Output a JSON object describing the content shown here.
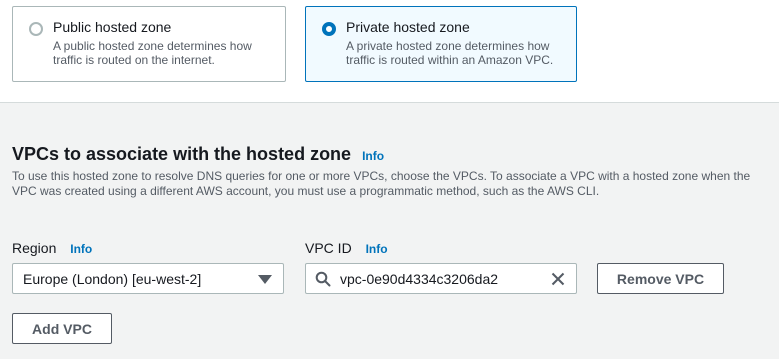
{
  "zone_type": {
    "options": [
      {
        "title": "Public hosted zone",
        "description": "A public hosted zone determines how traffic is routed on the internet.",
        "selected": false
      },
      {
        "title": "Private hosted zone",
        "description": "A private hosted zone determines how traffic is routed within an Amazon VPC.",
        "selected": true
      }
    ]
  },
  "vpc_section": {
    "title": "VPCs to associate with the hosted zone",
    "info_label": "Info",
    "description": "To use this hosted zone to resolve DNS queries for one or more VPCs, choose the VPCs. To associate a VPC with a hosted zone when the VPC was created using a different AWS account, you must use a programmatic method, such as the AWS CLI."
  },
  "region": {
    "label": "Region",
    "info_label": "Info",
    "value": "Europe (London) [eu-west-2]"
  },
  "vpc_id": {
    "label": "VPC ID",
    "info_label": "Info",
    "value": "vpc-0e90d4334c3206da2"
  },
  "buttons": {
    "remove_vpc": "Remove VPC",
    "add_vpc": "Add VPC"
  },
  "colors": {
    "accent": "#0073bb",
    "text": "#16191f",
    "secondary_text": "#545b64"
  },
  "icons": {
    "search": "search-icon",
    "clear": "close-icon",
    "dropdown": "caret-down-icon"
  }
}
